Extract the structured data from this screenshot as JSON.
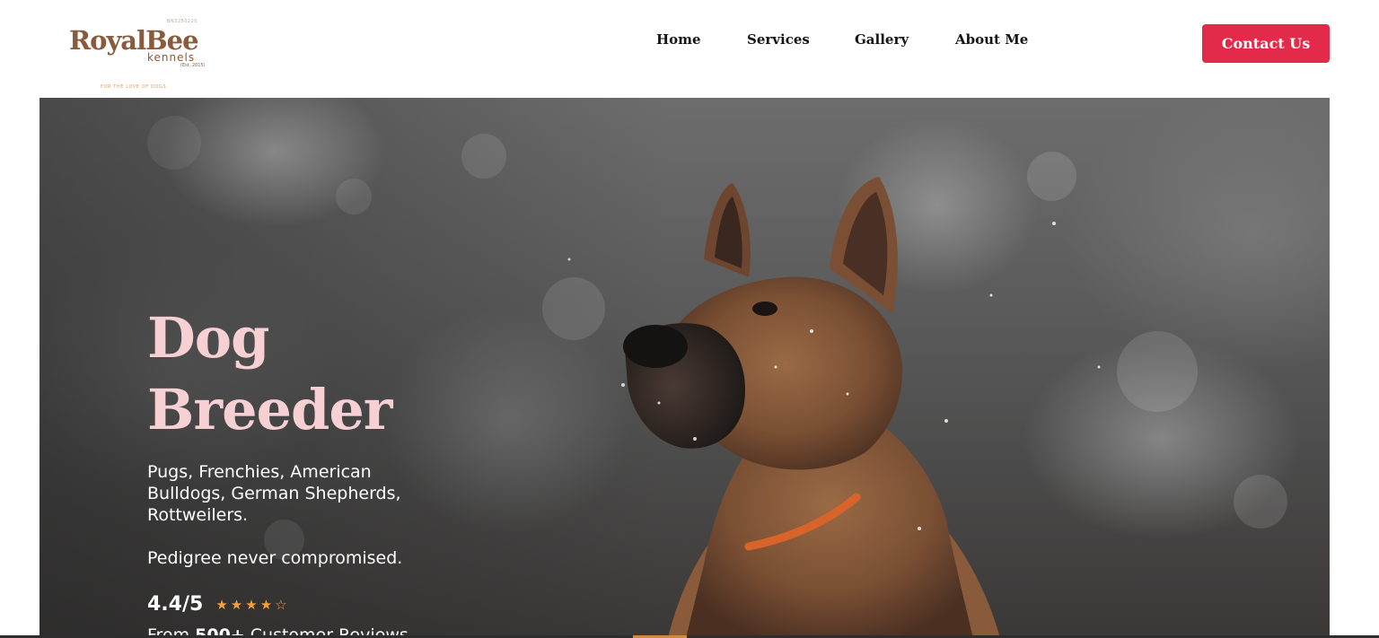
{
  "logo": {
    "reg": "BN3250225",
    "name": "RoyalBee",
    "sub": "kennels",
    "est": "(Est. 2015)",
    "tagline": "FOR THE LOVE OF DOGS"
  },
  "nav": {
    "items": [
      {
        "label": "Home"
      },
      {
        "label": "Services"
      },
      {
        "label": "Gallery"
      },
      {
        "label": "About Me"
      }
    ],
    "contact_label": "Contact Us"
  },
  "hero": {
    "title_line1": "Dog",
    "title_line2": "Breeder",
    "description": "Pugs, Frenchies, American Bulldogs, German Shepherds, Rottweilers.",
    "pedigree": "Pedigree never compromised.",
    "rating_value": "4.4/5",
    "rating_stars": 4.4,
    "rating_max": 5,
    "reviews_prefix": "From ",
    "reviews_count": "500+",
    "reviews_suffix": " Customer Reviews"
  },
  "colors": {
    "accent": "#e32a4a",
    "title": "#f6d0d3",
    "star": "#f2a03d",
    "brand": "#8a5a3d"
  },
  "icons": {
    "star_full": "star-icon",
    "star_empty": "star-outline-icon"
  }
}
